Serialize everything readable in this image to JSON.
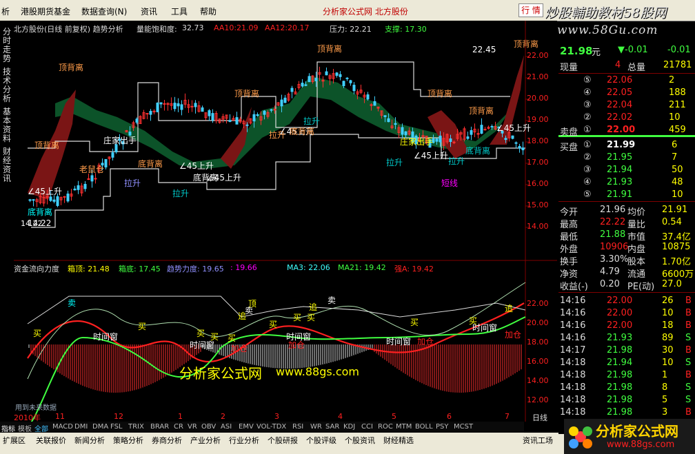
{
  "menu": {
    "items": [
      "析",
      "港股期货基金",
      "数据查询(N)",
      "资讯",
      "工具",
      "帮助"
    ],
    "brand": "分析家公式网 北方股份",
    "trade_btn": "行 情"
  },
  "watermark": {
    "line1": "炒股輔助教材58股网",
    "line2": "www.58Gu.com"
  },
  "left_tabs": [
    "分时走势",
    "技术分析",
    "基本资料",
    "财经资讯"
  ],
  "main_info": {
    "title": "北方股份(日线 前复权) 趋势分析",
    "saturation_label": "量能饱和度:",
    "saturation": "32.73",
    "aa10": "AA10:21.09",
    "aa12": "AA12:20.17",
    "pressure": "压力: 22.21",
    "support": "支撑: 17.30"
  },
  "price_axis": [
    "22.00",
    "21.00",
    "20.00",
    "19.00",
    "18.00",
    "17.00",
    "16.00",
    "15.00",
    "14.00"
  ],
  "price_labels": {
    "high": "22.45",
    "low": "14.22"
  },
  "annotations": [
    {
      "t": "顶背离",
      "c": "#ff9c4a"
    },
    {
      "t": "底背离",
      "c": "#ff9c4a"
    },
    {
      "t": "∠45上升",
      "c": "#fff"
    },
    {
      "t": "拉升",
      "c": "#9090ff"
    },
    {
      "t": "老鼠仓",
      "c": "#ff9c4a"
    },
    {
      "t": "庄家出手",
      "c": "#fff"
    },
    {
      "t": "短线",
      "c": "#ff00ff"
    },
    {
      "t": "拉升",
      "c": "#00c8c8"
    }
  ],
  "sub_info": {
    "name": "资金流向力度",
    "box_top": "箱顶: 21.48",
    "box_bottom": "箱底: 17.45",
    "power": "趋势力度: 19.65",
    "val": ": 19.66",
    "ma3": "MA3: 22.06",
    "ma21": "MA21: 19.42",
    "strong": "强A: 19.42"
  },
  "sub_axis": [
    "22.00",
    "20.00",
    "18.00",
    "16.00",
    "14.00",
    "12.00"
  ],
  "sub_labels": [
    "买",
    "卖",
    "顶",
    "时间窗",
    "追",
    "加仓",
    "买",
    "买"
  ],
  "overlay": {
    "brand": "分析家公式网",
    "url": "www.88gs.com",
    "credit": "用到未来数据"
  },
  "time_axis": [
    "2010年",
    "11",
    "12",
    "1",
    "2",
    "3",
    "4",
    "5",
    "6",
    "7"
  ],
  "period": "日线",
  "bottom_tabs": [
    "指标",
    "模板",
    "全部",
    "MACD",
    "DMI",
    "DMA",
    "FSL",
    "TRIX",
    "BRAR",
    "CR",
    "VR",
    "OBV",
    "ASI",
    "EMV",
    "VOL-TDX",
    "RSI",
    "WR",
    "SAR",
    "KDJ",
    "CCI",
    "ROC",
    "MTM",
    "BOLL",
    "PSY",
    "MCST"
  ],
  "tabs2": [
    "扩展区",
    "关联报价",
    "新闻分析",
    "策略分析",
    "券商分析",
    "产业分析",
    "行业分析",
    "个股研报",
    "个股评级",
    "个股资讯",
    "财经精选"
  ],
  "tabs2_right": "资讯工场",
  "quote": {
    "last": "21.98",
    "unit": "元",
    "change": "▼-0.01",
    "change2": "-0.01",
    "now_vol_label": "现量",
    "now_vol": "4",
    "total_vol_label": "总量",
    "total_vol": "21781",
    "asks": [
      {
        "n": "⑤",
        "p": "22.06",
        "v": "2"
      },
      {
        "n": "④",
        "p": "22.05",
        "v": "188"
      },
      {
        "n": "③",
        "p": "22.04",
        "v": "211"
      },
      {
        "n": "②",
        "p": "22.02",
        "v": "10"
      },
      {
        "n": "①",
        "p": "22.00",
        "v": "459"
      }
    ],
    "ask_label": "卖盘",
    "bid_label": "买盘",
    "bids": [
      {
        "n": "①",
        "p": "21.99",
        "v": "6"
      },
      {
        "n": "②",
        "p": "21.95",
        "v": "7"
      },
      {
        "n": "③",
        "p": "21.94",
        "v": "50"
      },
      {
        "n": "④",
        "p": "21.93",
        "v": "48"
      },
      {
        "n": "⑤",
        "p": "21.91",
        "v": "10"
      }
    ],
    "stats": [
      {
        "a": "今开",
        "av": "21.96",
        "b": "均价",
        "bv": "21.91"
      },
      {
        "a": "最高",
        "av": "22.22",
        "b": "量比",
        "bv": "0.54"
      },
      {
        "a": "最低",
        "av": "21.88",
        "b": "市值",
        "bv": "37.4亿"
      },
      {
        "a": "外盘",
        "av": "10906",
        "b": "内盘",
        "bv": "10875"
      },
      {
        "a": "换手",
        "av": "3.30%",
        "b": "股本",
        "bv": "1.70亿"
      },
      {
        "a": "净资",
        "av": "4.79",
        "b": "流通",
        "bv": "6600万"
      },
      {
        "a": "收益(-)",
        "av": "0.20",
        "b": "PE(动)",
        "bv": "27.0"
      }
    ],
    "ticks": [
      {
        "t": "14:16",
        "p": "22.00",
        "v": "26",
        "s": "B"
      },
      {
        "t": "14:16",
        "p": "22.00",
        "v": "10",
        "s": "B"
      },
      {
        "t": "14:16",
        "p": "22.00",
        "v": "18",
        "s": "B"
      },
      {
        "t": "14:16",
        "p": "21.93",
        "v": "89",
        "s": "S"
      },
      {
        "t": "14:17",
        "p": "21.98",
        "v": "30",
        "s": "B"
      },
      {
        "t": "14:18",
        "p": "21.94",
        "v": "10",
        "s": "S"
      },
      {
        "t": "14:18",
        "p": "21.98",
        "v": "1",
        "s": "B"
      },
      {
        "t": "14:18",
        "p": "21.98",
        "v": "8",
        "s": "S"
      },
      {
        "t": "14:18",
        "p": "21.98",
        "v": "5",
        "s": "S"
      },
      {
        "t": "14:18",
        "p": "21.98",
        "v": "3",
        "s": "B"
      }
    ]
  },
  "logo2": {
    "t1": "分析家公式网",
    "t2": "www.88gs.com"
  }
}
